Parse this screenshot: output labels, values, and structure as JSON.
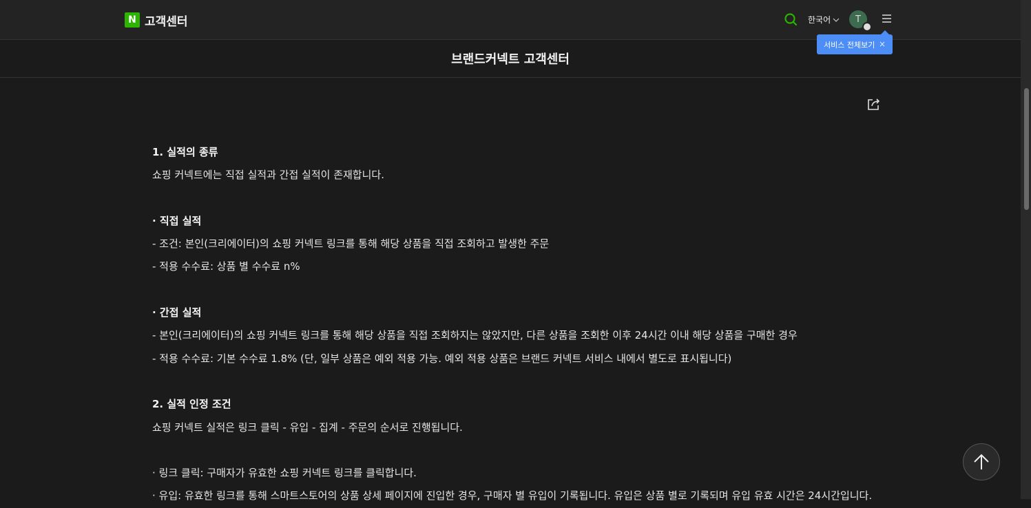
{
  "header": {
    "logo_letter": "N",
    "title": "고객센터",
    "language": "한국어",
    "avatar_letter": "T",
    "tooltip": "서비스 전체보기",
    "tooltip_close": "×"
  },
  "page": {
    "title": "브랜드커넥트 고객센터"
  },
  "article": {
    "lines": [
      {
        "text": "1. 실적의 종류",
        "type": "head"
      },
      {
        "text": "쇼핑 커넥트에는 직접 실적과 간접 실적이 존재합니다.",
        "type": "text"
      },
      {
        "text": "",
        "type": "gap"
      },
      {
        "text": "· 직접 실적",
        "type": "head"
      },
      {
        "text": "- 조건: 본인(크리에이터)의 쇼핑 커넥트 링크를 통해 해당 상품을 직접 조회하고 발생한 주문",
        "type": "text"
      },
      {
        "text": "- 적용 수수료: 상품 별 수수료 n%",
        "type": "text"
      },
      {
        "text": "",
        "type": "gap"
      },
      {
        "text": "· 간접 실적",
        "type": "head"
      },
      {
        "text": "- 본인(크리에이터)의 쇼핑 커넥트 링크를 통해 해당 상품을 직접 조회하지는 않았지만, 다른 상품을 조회한 이후 24시간 이내 해당 상품을 구매한 경우",
        "type": "text"
      },
      {
        "text": "- 적용 수수료: 기본 수수료 1.8% (단, 일부 상품은 예외 적용 가능. 예외 적용 상품은 브랜드 커넥트 서비스 내에서 별도로 표시됩니다)",
        "type": "text"
      },
      {
        "text": "",
        "type": "gap"
      },
      {
        "text": "2. 실적 인정 조건",
        "type": "head"
      },
      {
        "text": "쇼핑 커넥트 실적은 링크 클릭 - 유입 - 집계 - 주문의 순서로 진행됩니다.",
        "type": "text"
      },
      {
        "text": "",
        "type": "gap"
      },
      {
        "text": "· 링크 클릭: 구매자가 유효한 쇼핑 커넥트 링크를 클릭합니다.",
        "type": "text"
      },
      {
        "text": "· 유입: 유효한 링크를 통해 스마트스토어의 상품 상세 페이지에 진입한 경우, 구매자 별 유입이 기록됩니다. 유입은 상품 별로 기록되며 유입 유효 시간은 24시간입니다.",
        "type": "text"
      }
    ]
  },
  "colors": {
    "background": "#1b1b1b",
    "header_bg": "#232323",
    "logo_green": "#2db400",
    "tooltip_blue": "#4c8df6",
    "search_green": "#2db400"
  }
}
